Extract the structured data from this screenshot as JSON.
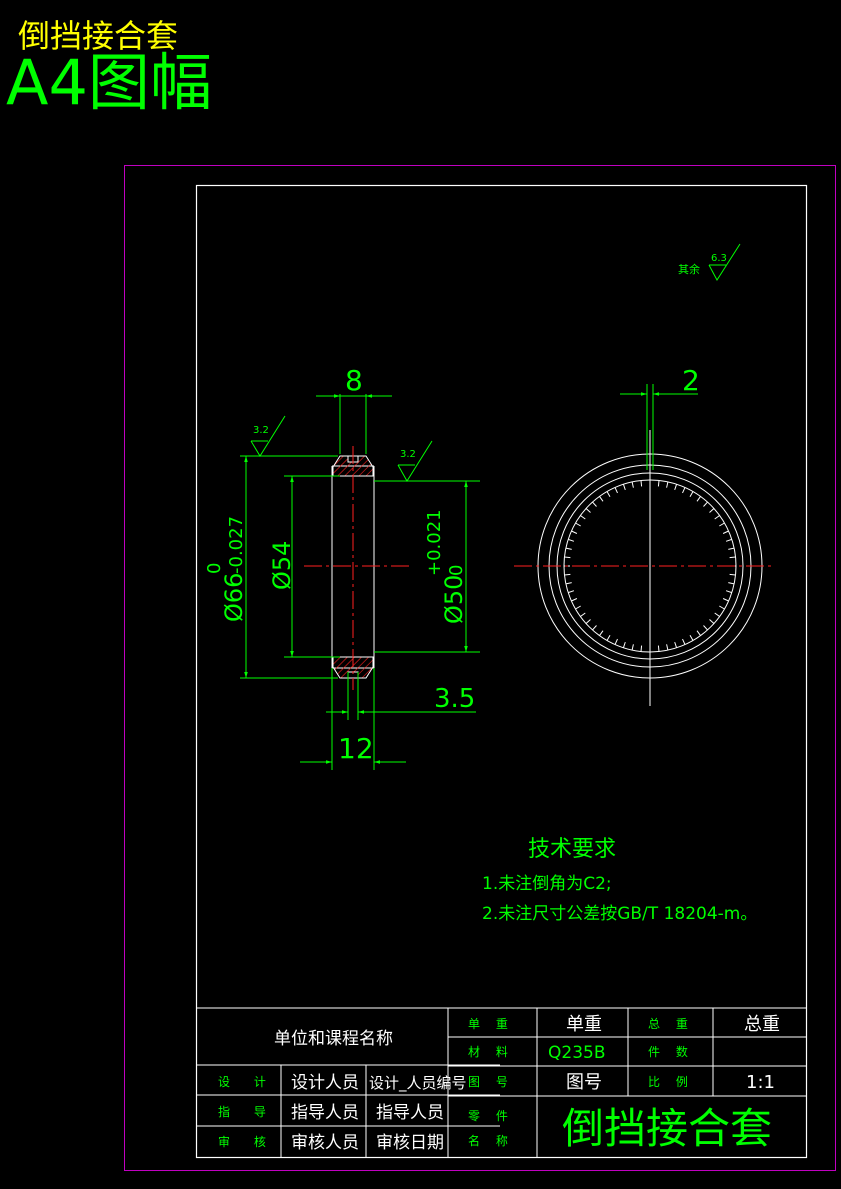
{
  "header": {
    "title_yellow": "倒挡接合套",
    "title_green": "A4图幅"
  },
  "roughness": {
    "general_label": "其余",
    "general_value": "6.3",
    "left_value": "3.2",
    "right_value": "3.2"
  },
  "dimensions": {
    "top_width": "8",
    "right_view_gap": "2",
    "d66_main": "Ø66",
    "d66_upper": "0",
    "d66_lower": "-0.027",
    "d54": "Ø54",
    "d50_main": "Ø50",
    "d50_upper": "+0.021",
    "d50_lower": "0",
    "groove": "3.5",
    "bottom_width": "12"
  },
  "notes": {
    "heading": "技术要求",
    "line1": "1.未注倒角为C2;",
    "line2": "2.未注尺寸公差按GB/T 18204-m。"
  },
  "title_block": {
    "unit_name": "单位和课程名称",
    "label_unit_weight": "单 重",
    "value_unit_weight": "单重",
    "label_total_weight": "总 重",
    "value_total_weight": "总重",
    "label_material": "材 料",
    "value_material": "Q235B",
    "label_quantity": "件 数",
    "value_quantity": "",
    "label_design": "设 计",
    "value_designer": "设计人员",
    "value_designer_id": "设计_人员编号",
    "label_drawing_no": "图 号",
    "value_drawing_no": "图号",
    "label_scale": "比 例",
    "value_scale": "1:1",
    "label_guide": "指 导",
    "value_guide": "指导人员",
    "value_guide2": "指导人员",
    "label_part_1": "零 件",
    "label_part_2": "名 称",
    "label_review": "审 核",
    "value_reviewer": "审核人员",
    "value_review_date": "审核日期",
    "part_name": "倒挡接合套"
  },
  "colors": {
    "border_outer": "#c000c0",
    "frame": "#ffffff",
    "dimension": "#00ff00",
    "center_line": "#ff0000",
    "title_yellow": "#ffff00"
  }
}
